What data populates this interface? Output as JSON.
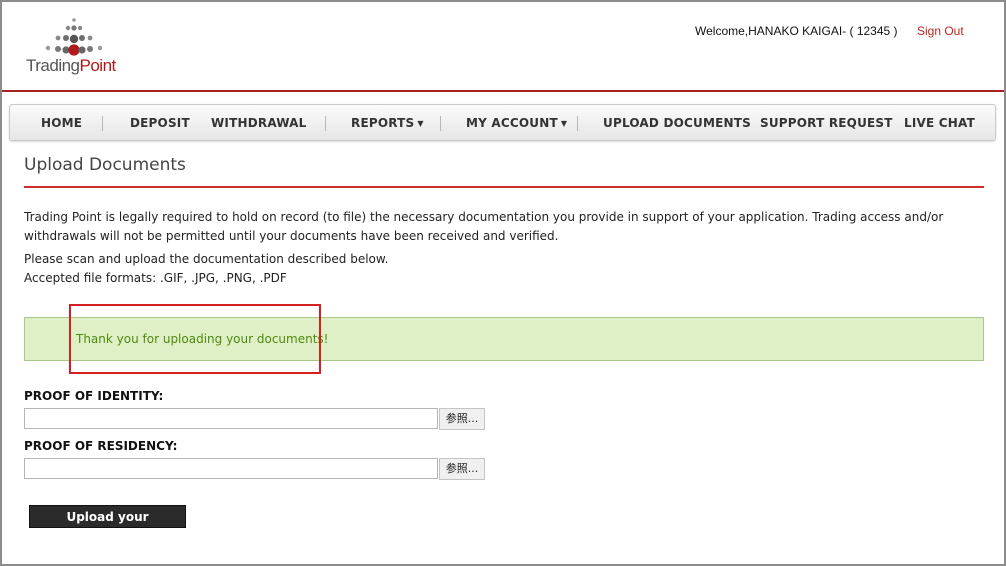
{
  "header": {
    "logo_text_main": "Trading",
    "logo_text_accent": "Point",
    "welcome": "Welcome,HANAKO KAIGAI- ( 12345 )",
    "signout": "Sign Out"
  },
  "nav": {
    "home": "HOME",
    "deposit": "DEPOSIT",
    "withdrawal": "WITHDRAWAL",
    "reports": "REPORTS",
    "my_account": "MY ACCOUNT",
    "upload_documents": "UPLOAD DOCUMENTS",
    "support_request": "SUPPORT REQUEST",
    "live_chat": "LIVE CHAT"
  },
  "main": {
    "title": "Upload Documents",
    "intro": "Trading Point is legally required to hold on record (to file) the necessary documentation you provide in support of your application. Trading access and/or withdrawals will not be permitted until your documents have been received and verified.",
    "instructions_line1": "Please scan and upload the documentation described below.",
    "instructions_line2": "Accepted file formats: .GIF, .JPG, .PNG, .PDF",
    "success_message": "Thank you for uploading your documents!",
    "proof_identity_label": "PROOF OF IDENTITY:",
    "proof_residency_label": "PROOF OF RESIDENCY:",
    "browse_label": "参照...",
    "upload_button": "Upload your Documents"
  },
  "colors": {
    "accent_red": "#a52121",
    "success_bg": "#dff0c6",
    "success_text": "#4f8a10"
  }
}
